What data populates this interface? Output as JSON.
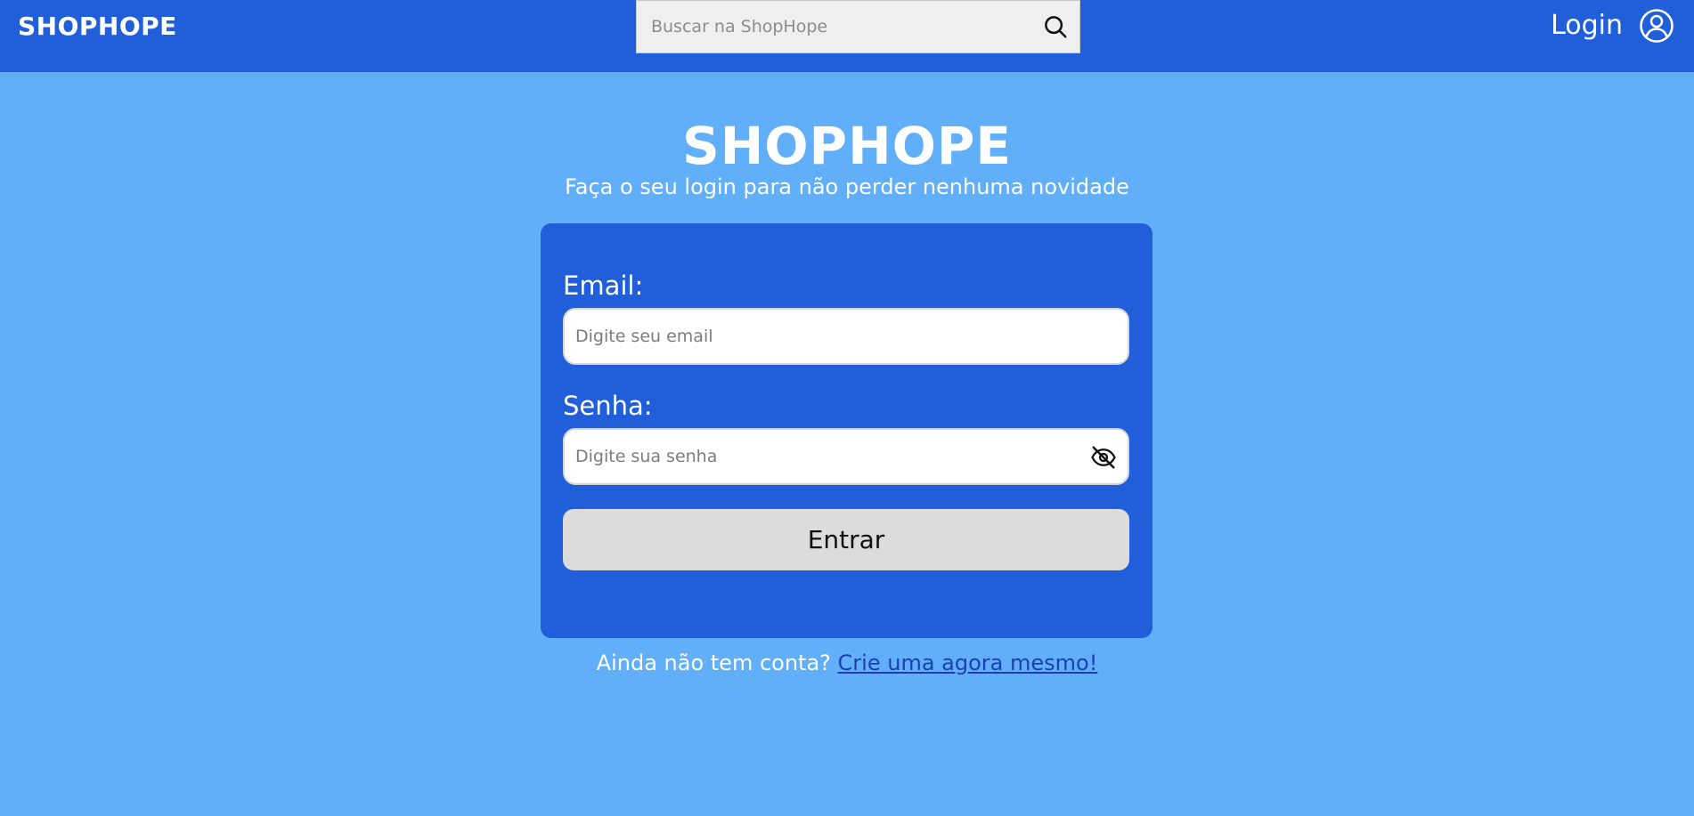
{
  "header": {
    "brand": "SHOPHOPE",
    "search": {
      "placeholder": "Buscar na ShopHope",
      "value": "",
      "icon": "search-icon"
    },
    "login_label": "Login",
    "user_icon": "user-circle-icon"
  },
  "main": {
    "title": "SHOPHOPE",
    "subtitle": "Faça o seu login para não perder nenhuma novidade"
  },
  "form": {
    "email_label": "Email:",
    "email_placeholder": "Digite seu email",
    "email_value": "",
    "password_label": "Senha:",
    "password_placeholder": "Digite sua senha",
    "password_value": "",
    "password_visibility_icon": "eye-off-icon",
    "submit_label": "Entrar"
  },
  "footer": {
    "prompt": "Ainda não tem conta?",
    "link_label": "Crie uma agora mesmo!"
  },
  "colors": {
    "page_background": "#60aff8",
    "header_background": "#205fd9",
    "card_background": "#205fd9",
    "button_background": "#dcdcdc",
    "link_color": "#1e3fb3"
  }
}
